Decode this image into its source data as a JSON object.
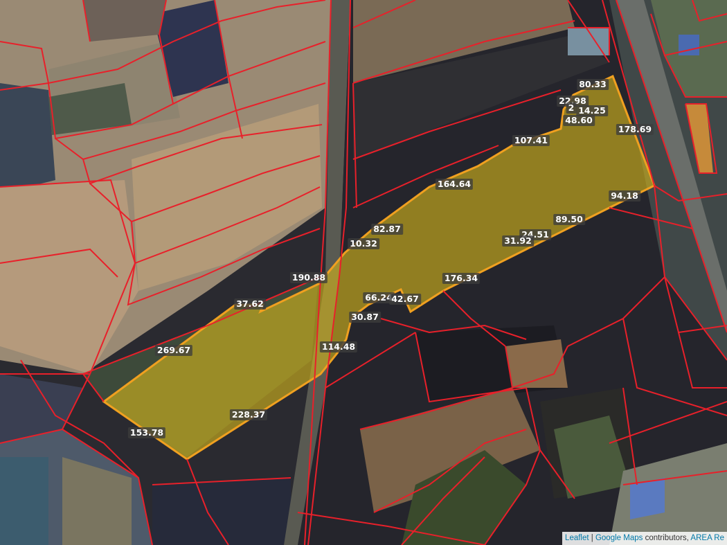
{
  "colors": {
    "parcel_line": "#e8202a",
    "highlight_fill": "#d4b51c",
    "highlight_stroke": "#f0a020",
    "label_bg": "#3c3c3c",
    "label_text": "#ffffff"
  },
  "measurements": [
    "80.33",
    "22.98",
    "2",
    "14.25",
    "48.60",
    "178.69",
    "107.41",
    "164.64",
    "94.18",
    "89.50",
    "82.87",
    "24.51",
    "10.32",
    "31.92",
    "190.88",
    "176.34",
    "66.24",
    "42.67",
    "37.62",
    "30.87",
    "114.48",
    "269.67",
    "228.37",
    "153.78"
  ],
  "attribution": {
    "leaflet": "Leaflet",
    "sep": " | ",
    "google": "Google Maps",
    "contrib": " contributors, ",
    "area": "AREA Re"
  }
}
